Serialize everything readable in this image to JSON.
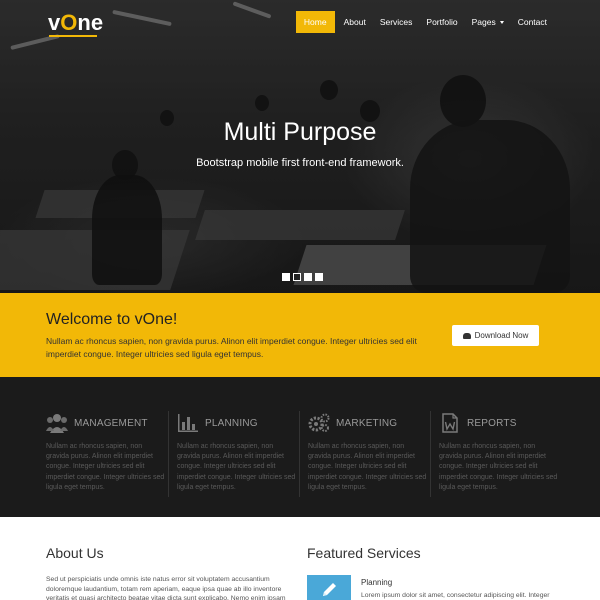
{
  "brand": {
    "logo_part1": "v",
    "logo_o": "O",
    "logo_part2": "ne",
    "accent": "#f2b807"
  },
  "nav": {
    "items": [
      "Home",
      "About",
      "Services",
      "Portfolio",
      "Pages",
      "Contact"
    ],
    "active": "Home"
  },
  "hero": {
    "title": "Multi Purpose",
    "subtitle": "Bootstrap mobile first front-end framework.",
    "slides": 4,
    "active_slide": 2
  },
  "welcome": {
    "title": "Welcome to vOne!",
    "text": "Nullam ac rhoncus sapien, non gravida purus. Alinon elit imperdiet congue. Integer ultricies sed elit imperdiet congue. Integer ultricies sed ligula eget tempus.",
    "download_label": "Download Now",
    "download_icon": "cloud-download-icon"
  },
  "features": [
    {
      "label": "MANAGEMENT",
      "icon": "people-icon",
      "text": "Nullam ac rhoncus sapien, non gravida purus. Alinon elit imperdiet congue. Integer ultricies sed elit imperdiet congue. Integer ultricies sed ligula eget tempus."
    },
    {
      "label": "PLANNING",
      "icon": "bar-chart-icon",
      "text": "Nullam ac rhoncus sapien, non gravida purus. Alinon elit imperdiet congue. Integer ultricies sed elit imperdiet congue. Integer ultricies sed ligula eget tempus."
    },
    {
      "label": "MARKETING",
      "icon": "gears-icon",
      "text": "Nullam ac rhoncus sapien, non gravida purus. Alinon elit imperdiet congue. Integer ultricies sed elit imperdiet congue. Integer ultricies sed ligula eget tempus."
    },
    {
      "label": "REPORTS",
      "icon": "document-icon",
      "text": "Nullam ac rhoncus sapien, non gravida purus. Alinon elit imperdiet congue. Integer ultricies sed elit imperdiet congue. Integer ultricies sed ligula eget tempus."
    }
  ],
  "about": {
    "title": "About Us",
    "text": "Sed ut perspiciatis unde omnis iste natus error sit voluptatem accusantium doloremque laudantium, totam rem aperiam, eaque ipsa quae ab illo inventore veritatis et quasi architecto beatae vitae dicta sunt explicabo. Nemo enim ipsam"
  },
  "featured_services": {
    "title": "Featured Services",
    "item_title": "Planning",
    "item_text": "Lorem ipsum dolor sit amet, consectetur adipiscing elit. Integer",
    "item_icon": "pencil-icon",
    "item_color": "#4aa8d8"
  }
}
